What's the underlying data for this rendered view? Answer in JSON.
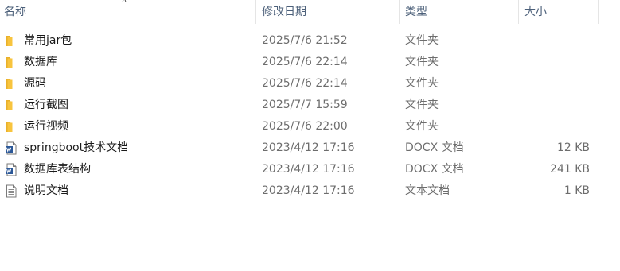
{
  "columns": {
    "name": "名称",
    "date": "修改日期",
    "type": "类型",
    "size": "大小"
  },
  "sort_indicator": "chevron-up",
  "files": [
    {
      "name": "常用jar包",
      "date": "2025/7/6 21:52",
      "type": "文件夹",
      "size": "",
      "icon": "folder-icon"
    },
    {
      "name": "数据库",
      "date": "2025/7/6 22:14",
      "type": "文件夹",
      "size": "",
      "icon": "folder-icon"
    },
    {
      "name": "源码",
      "date": "2025/7/6 22:14",
      "type": "文件夹",
      "size": "",
      "icon": "folder-icon"
    },
    {
      "name": "运行截图",
      "date": "2025/7/7 15:59",
      "type": "文件夹",
      "size": "",
      "icon": "folder-icon"
    },
    {
      "name": "运行视频",
      "date": "2025/7/6 22:00",
      "type": "文件夹",
      "size": "",
      "icon": "folder-icon"
    },
    {
      "name": "springboot技术文档",
      "date": "2023/4/12 17:16",
      "type": "DOCX 文档",
      "size": "12 KB",
      "icon": "word-doc-icon"
    },
    {
      "name": "数据库表结构",
      "date": "2023/4/12 17:16",
      "type": "DOCX 文档",
      "size": "241 KB",
      "icon": "word-doc-icon"
    },
    {
      "name": "说明文档",
      "date": "2023/4/12 17:16",
      "type": "文本文档",
      "size": "1 KB",
      "icon": "text-file-icon"
    }
  ],
  "colors": {
    "header_text": "#4c607a",
    "folder": "#f8c43e",
    "word": "#2b5797",
    "secondary_text": "#6d6d6d"
  }
}
